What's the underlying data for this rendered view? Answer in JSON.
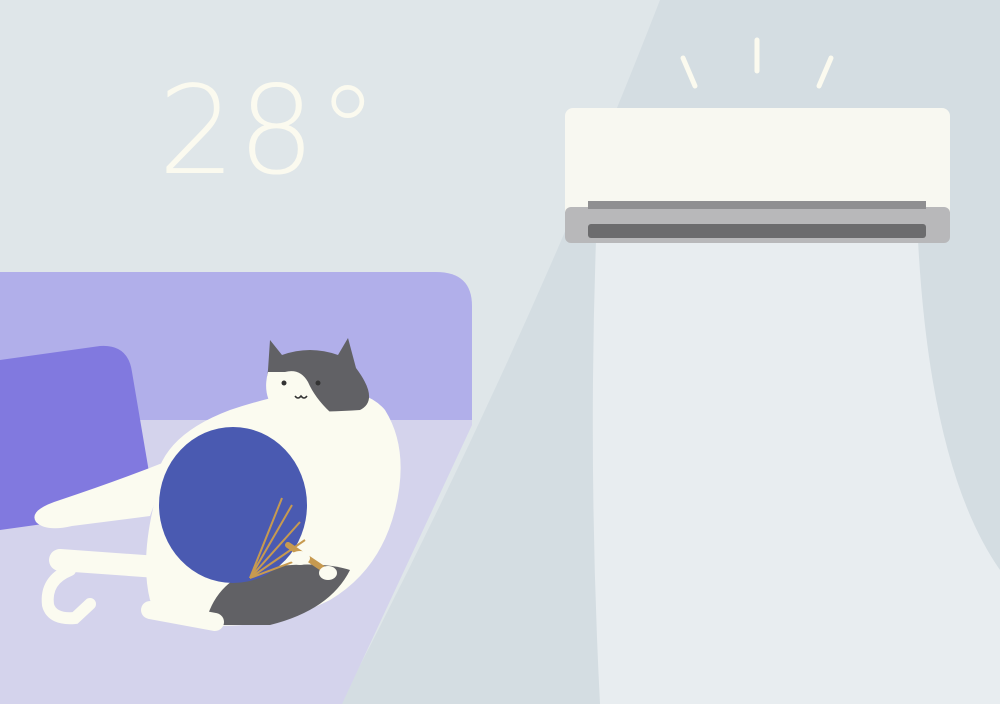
{
  "temperature": {
    "display": "28°"
  },
  "colors": {
    "wall": "#dfe6e9",
    "wall_shade": "#d3dde2",
    "air_stream": "#e9eef0",
    "sofa_back": "#b1afea",
    "sofa_seat": "#d3d2ec",
    "pillow": "#8179df",
    "cat_body": "#fbfbf0",
    "cat_patch": "#616165",
    "fan": "#4a5ab1",
    "fan_handle": "#c79a50",
    "ac_body": "#f8f8f1",
    "ac_vent": "#b9b9bb"
  },
  "icons": [
    "air-conditioner-icon",
    "cat-illustration",
    "paper-fan-icon",
    "sofa-icon",
    "pillow-icon"
  ]
}
